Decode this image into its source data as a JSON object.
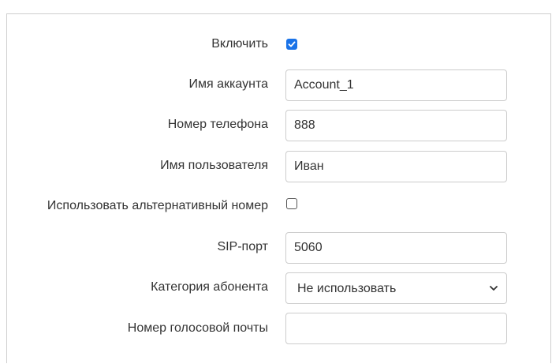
{
  "form": {
    "enable": {
      "label": "Включить",
      "checked": true
    },
    "account_name": {
      "label": "Имя аккаунта",
      "value": "Account_1"
    },
    "phone_number": {
      "label": "Номер телефона",
      "value": "888"
    },
    "username": {
      "label": "Имя пользователя",
      "value": "Иван"
    },
    "use_alt_number": {
      "label": "Использовать альтернативный номер",
      "checked": false
    },
    "sip_port": {
      "label": "SIP-порт",
      "value": "5060"
    },
    "subscriber_category": {
      "label": "Категория абонента",
      "selected": "Не использовать"
    },
    "voicemail_number": {
      "label": "Номер голосовой почты",
      "value": ""
    }
  },
  "colors": {
    "checkbox_checked": "#1a73e8",
    "border": "#cccccc",
    "text": "#333333"
  },
  "icons": {
    "checkmark": "check-icon",
    "dropdown": "chevron-down-icon"
  }
}
